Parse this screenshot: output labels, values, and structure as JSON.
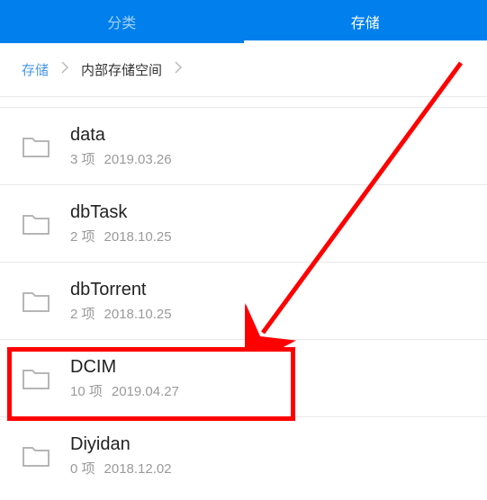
{
  "tabs": {
    "left": "分类",
    "right": "存储"
  },
  "breadcrumb": {
    "root": "存储",
    "current": "内部存储空间"
  },
  "folders": [
    {
      "name": "data",
      "count": "3 项",
      "date": "2019.03.26"
    },
    {
      "name": "dbTask",
      "count": "2 项",
      "date": "2018.10.25"
    },
    {
      "name": "dbTorrent",
      "count": "2 项",
      "date": "2018.10.25"
    },
    {
      "name": "DCIM",
      "count": "10 项",
      "date": "2019.04.27"
    },
    {
      "name": "Diyidan",
      "count": "0 项",
      "date": "2018.12.02"
    }
  ],
  "annotation": {
    "highlight_index": 3
  }
}
